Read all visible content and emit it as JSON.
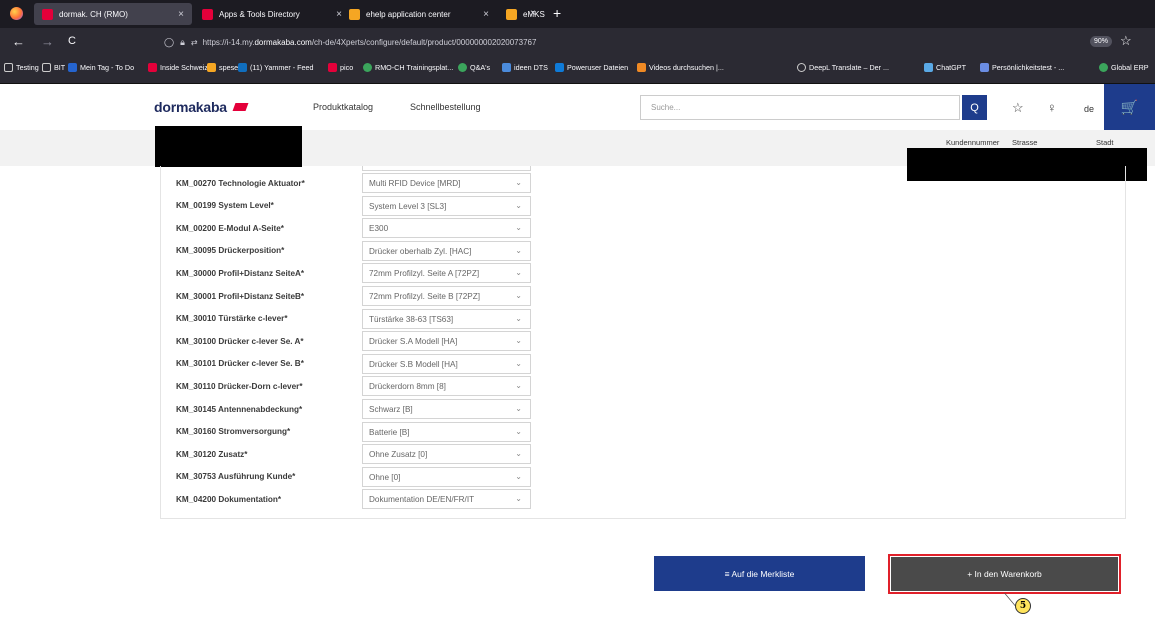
{
  "browser": {
    "tabs": [
      {
        "label": "dormak. CH (RMO)",
        "close": "×",
        "fav_color": "#e4003a"
      },
      {
        "label": "Apps & Tools Directory",
        "close": "×",
        "fav_color": "#e4003a"
      },
      {
        "label": "ehelp application center",
        "close": "×",
        "fav_color": "#f5a623"
      },
      {
        "label": "eMKS",
        "close": "×",
        "fav_color": "#f5a623"
      }
    ],
    "new_tab": "+",
    "back": "←",
    "forward": "→",
    "reload": "C",
    "url_prefix": "https://i-14.my.",
    "url_host": "dormakaba.com",
    "url_path": "/ch-de/4Xperts/configure/default/product/000000002020073767",
    "zoom": "90%",
    "star": "☆",
    "bookmarks": [
      {
        "label": "Testing"
      },
      {
        "label": "BIT"
      },
      {
        "label": "Mein Tag - To Do"
      },
      {
        "label": "Inside Schweiz"
      },
      {
        "label": "spese"
      },
      {
        "label": "(11) Yammer - Feed"
      },
      {
        "label": "pico"
      },
      {
        "label": "RMO-CH Trainingsplat..."
      },
      {
        "label": "Q&A's"
      },
      {
        "label": "ideen DTS"
      },
      {
        "label": "Poweruser Dateien"
      },
      {
        "label": "Videos durchsuchen |..."
      },
      {
        "label": "DeepL Translate – Der ..."
      },
      {
        "label": "ChatGPT"
      },
      {
        "label": "Persönlichkeitstest - ..."
      },
      {
        "label": "Global ERP"
      }
    ]
  },
  "header": {
    "logo": "dormakaba",
    "nav": [
      "Produktkatalog",
      "Schnellbestellung"
    ],
    "search_placeholder": "Suche...",
    "search_icon": "Q",
    "pin_icon": "☆",
    "user_icon": "♀",
    "language": "de",
    "cart_icon": "🛒"
  },
  "subbar": {
    "col1": "Kundennummer",
    "col2": "Strasse",
    "col3": "Stadt"
  },
  "config": {
    "chevron": "⌄",
    "rows": [
      {
        "label": "KM_00270 Technologie Aktuator*",
        "value": "Multi RFID Device [MRD]"
      },
      {
        "label": "KM_00199 System Level*",
        "value": "System Level 3 [SL3]"
      },
      {
        "label": "KM_00200 E-Modul A-Seite*",
        "value": "E300"
      },
      {
        "label": "KM_30095 Drückerposition*",
        "value": "Drücker oberhalb Zyl. [HAC]"
      },
      {
        "label": "KM_30000 Profil+Distanz SeiteA*",
        "value": "72mm Profilzyl. Seite A [72PZ]"
      },
      {
        "label": "KM_30001 Profil+Distanz SeiteB*",
        "value": "72mm Profilzyl. Seite B [72PZ]"
      },
      {
        "label": "KM_30010 Türstärke c-lever*",
        "value": "Türstärke 38-63 [TS63]"
      },
      {
        "label": "KM_30100 Drücker c-lever Se. A*",
        "value": "Drücker S.A Modell [HA]"
      },
      {
        "label": "KM_30101 Drücker c-lever Se. B*",
        "value": "Drücker S.B Modell [HA]"
      },
      {
        "label": "KM_30110 Drücker-Dorn c-lever*",
        "value": "Drückerdorn 8mm [8]"
      },
      {
        "label": "KM_30145 Antennenabdeckung*",
        "value": "Schwarz [B]"
      },
      {
        "label": "KM_30160 Stromversorgung*",
        "value": "Batterie [B]"
      },
      {
        "label": "KM_30120 Zusatz*",
        "value": "Ohne Zusatz [0]"
      },
      {
        "label": "KM_30753 Ausführung Kunde*",
        "value": "Ohne [0]"
      },
      {
        "label": "KM_04200 Dokumentation*",
        "value": "Dokumentation DE/EN/FR/IT"
      }
    ]
  },
  "actions": {
    "merkliste": "≡  Auf die Merkliste",
    "warenkorb": "+  In den Warenkorb",
    "callout_number": "5"
  }
}
